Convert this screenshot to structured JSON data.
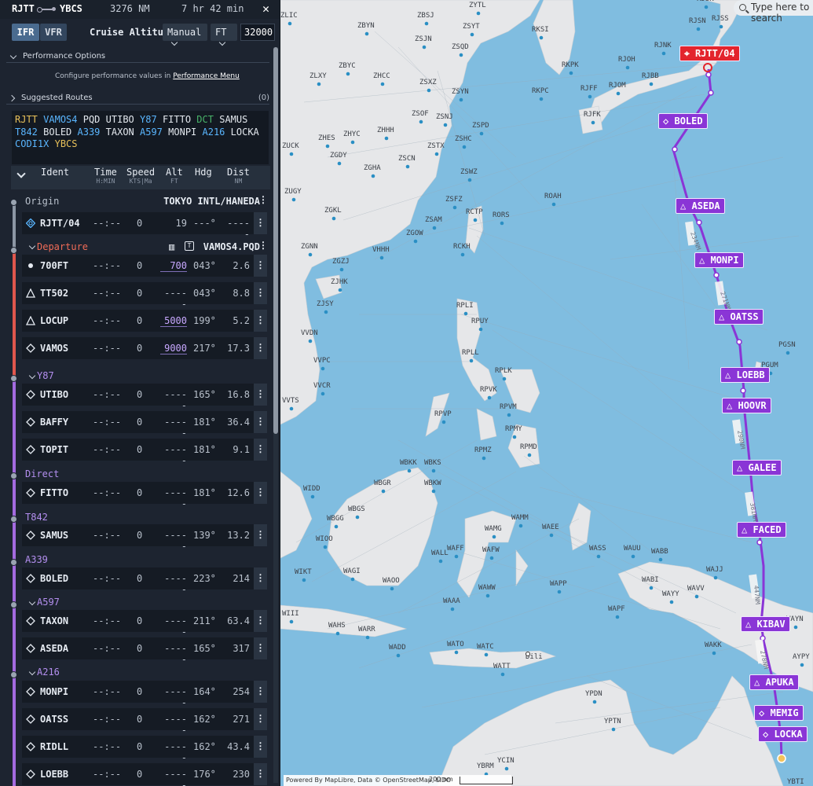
{
  "topbar": {
    "origin": "RJTT",
    "destination": "YBCS",
    "distance": "3276 NM",
    "duration": "7 hr 42 min",
    "close": "✕"
  },
  "mode": {
    "ifr": "IFR",
    "vfr": "VFR",
    "cruise_label": "Cruise Altitude",
    "altitude_mode": "Manual",
    "unit": "FT",
    "altitude": "32000"
  },
  "performance": {
    "title": "Performance Options",
    "desc": "Configure performance values in",
    "link": "Performance Menu"
  },
  "suggested": {
    "title": "Suggested Routes",
    "count": "(0)"
  },
  "route_tokens": [
    {
      "t": "RJTT",
      "c": "yellow"
    },
    {
      "t": "VAMOS4",
      "c": "blue"
    },
    {
      "t": "PQD",
      "c": "white"
    },
    {
      "t": "UTIBO",
      "c": "white"
    },
    {
      "t": "Y87",
      "c": "blue"
    },
    {
      "t": "FITTO",
      "c": "white"
    },
    {
      "t": "DCT",
      "c": "green"
    },
    {
      "t": "SAMUS",
      "c": "white"
    },
    {
      "t": "T842",
      "c": "blue"
    },
    {
      "t": "BOLED",
      "c": "white"
    },
    {
      "t": "A339",
      "c": "blue"
    },
    {
      "t": "TAXON",
      "c": "white"
    },
    {
      "t": "A597",
      "c": "blue"
    },
    {
      "t": "MONPI",
      "c": "white"
    },
    {
      "t": "A216",
      "c": "blue"
    },
    {
      "t": "LOCKA",
      "c": "white"
    },
    {
      "t": "CODI1X",
      "c": "blue"
    },
    {
      "t": "YBCS",
      "c": "yellow"
    }
  ],
  "columns": {
    "ident": "Ident",
    "time": "Time",
    "time_unit": "H:MIN",
    "speed": "Speed",
    "speed_unit": "KTS|Ma",
    "alt": "Alt",
    "alt_unit": "FT",
    "hdg": "Hdg",
    "dist": "Dist",
    "dist_unit": "NM"
  },
  "groups": {
    "origin": {
      "label": "Origin",
      "right": "TOKYO INTL/HANEDA"
    },
    "departure": {
      "label": "Departure",
      "right": "VAMOS4.PQD"
    },
    "y87": {
      "label": "Y87"
    },
    "direct": {
      "label": "Direct"
    },
    "t842": {
      "label": "T842"
    },
    "a339": {
      "label": "A339"
    },
    "a597": {
      "label": "A597"
    },
    "a216": {
      "label": "A216"
    }
  },
  "rows": [
    {
      "id": "RJTT/04",
      "time": "--:--",
      "speed": "0",
      "alt": "19",
      "hdg": "---°",
      "dist": "-----",
      "icon": "airport"
    },
    {
      "id": "700FT",
      "time": "--:--",
      "speed": "0",
      "alt": "700",
      "hdg": "043°",
      "dist": "2.6",
      "icon": "dot"
    },
    {
      "id": "TT502",
      "time": "--:--",
      "speed": "0",
      "alt": "-----",
      "hdg": "043°",
      "dist": "8.8",
      "icon": "triangle"
    },
    {
      "id": "LOCUP",
      "time": "--:--",
      "speed": "0",
      "alt": "5000",
      "hdg": "199°",
      "dist": "5.2",
      "icon": "triangle"
    },
    {
      "id": "VAMOS",
      "time": "--:--",
      "speed": "0",
      "alt": "9000",
      "hdg": "217°",
      "dist": "17.3",
      "icon": "diamond"
    },
    {
      "id": "UTIBO",
      "time": "--:--",
      "speed": "0",
      "alt": "-----",
      "hdg": "165°",
      "dist": "16.8",
      "icon": "diamond"
    },
    {
      "id": "BAFFY",
      "time": "--:--",
      "speed": "0",
      "alt": "-----",
      "hdg": "181°",
      "dist": "36.4",
      "icon": "diamond"
    },
    {
      "id": "TOPIT",
      "time": "--:--",
      "speed": "0",
      "alt": "-----",
      "hdg": "181°",
      "dist": "9.1",
      "icon": "diamond"
    },
    {
      "id": "FITTO",
      "time": "--:--",
      "speed": "0",
      "alt": "-----",
      "hdg": "181°",
      "dist": "12.6",
      "icon": "diamond"
    },
    {
      "id": "SAMUS",
      "time": "--:--",
      "speed": "0",
      "alt": "-----",
      "hdg": "139°",
      "dist": "13.2",
      "icon": "diamond"
    },
    {
      "id": "BOLED",
      "time": "--:--",
      "speed": "0",
      "alt": "-----",
      "hdg": "223°",
      "dist": "214",
      "icon": "diamond"
    },
    {
      "id": "TAXON",
      "time": "--:--",
      "speed": "0",
      "alt": "-----",
      "hdg": "211°",
      "dist": "63.4",
      "icon": "diamond"
    },
    {
      "id": "ASEDA",
      "time": "--:--",
      "speed": "0",
      "alt": "-----",
      "hdg": "165°",
      "dist": "317",
      "icon": "diamond"
    },
    {
      "id": "MONPI",
      "time": "--:--",
      "speed": "0",
      "alt": "-----",
      "hdg": "164°",
      "dist": "254",
      "icon": "diamond"
    },
    {
      "id": "OATSS",
      "time": "--:--",
      "speed": "0",
      "alt": "-----",
      "hdg": "162°",
      "dist": "271",
      "icon": "diamond"
    },
    {
      "id": "RIDLL",
      "time": "--:--",
      "speed": "0",
      "alt": "-----",
      "hdg": "162°",
      "dist": "43.4",
      "icon": "diamond"
    },
    {
      "id": "LOEBB",
      "time": "--:--",
      "speed": "0",
      "alt": "-----",
      "hdg": "176°",
      "dist": "230",
      "icon": "diamond"
    }
  ],
  "map": {
    "search_placeholder": "Type here to search",
    "attribution": "Powered By MapLibre, Data © OpenStreetMap, LIDO",
    "scale": "200 nm",
    "city": "Dili",
    "waypoints": [
      "RJTT/04",
      "BOLED",
      "ASEDA",
      "MONPI",
      "OATSS",
      "LOEBB",
      "HOOVR",
      "GALEE",
      "FACED",
      "KIBAV",
      "APUKA",
      "MEMIG",
      "LOCKA"
    ],
    "leg_labels": [
      "234NM",
      "271NM",
      "290NM",
      "381NM",
      "447NM",
      "278NM"
    ],
    "airports": [
      "ZLIC",
      "ZBYN",
      "ZSJN",
      "ZBSJ",
      "ZYTL",
      "ZSQD",
      "ZSYT",
      "RKSI",
      "RKPK",
      "RKPC",
      "ZLXY",
      "ZBYC",
      "ZHCC",
      "ZSXZ",
      "ZSYN",
      "ZSOF",
      "ZSNJ",
      "ZHHH",
      "ZSPD",
      "ZHES",
      "ZHYC",
      "ZSHC",
      "ZUCK",
      "ZGDY",
      "ZSTX",
      "ZSCN",
      "ZGHA",
      "ZSWZ",
      "ZUGY",
      "ZGKL",
      "ZSFZ",
      "ZSAM",
      "RCTP",
      "ROAH",
      "RORS",
      "ZGOW",
      "RCKH",
      "ZGNN",
      "ZGZJ",
      "VHHH",
      "ZJHK",
      "ZJSY",
      "VVDN",
      "VVPC",
      "VVCR",
      "VVTS",
      "RPLI",
      "RPUY",
      "RPLL",
      "RPLK",
      "RPVK",
      "RPVM",
      "RPMY",
      "RPVP",
      "RPMZ",
      "RPMD",
      "WBKK",
      "WBKS",
      "WBGR",
      "WBKW",
      "WIDD",
      "WBGS",
      "WBGG",
      "WIOO",
      "WAMM",
      "WAEE",
      "WAMG",
      "WAFF",
      "WAFW",
      "WALL",
      "WASS",
      "WAUU",
      "WABB",
      "WAJJ",
      "WIKT",
      "WAGI",
      "WAOO",
      "WABI",
      "WAYY",
      "WAVV",
      "WAPP",
      "WAWW",
      "WAAA",
      "WAPF",
      "WIII",
      "WAHS",
      "WARR",
      "WADD",
      "WATO",
      "WATC",
      "WATT",
      "WAKK",
      "YPDN",
      "YPTN",
      "YBRM",
      "YCIN",
      "RJOH",
      "RJNK",
      "RJSN",
      "RJSS",
      "RJOM",
      "RJBB",
      "RJFF",
      "RJFK",
      "RJSK",
      "PGSN",
      "PGUM",
      "AYPY",
      "WAYN",
      "YBTI"
    ]
  }
}
